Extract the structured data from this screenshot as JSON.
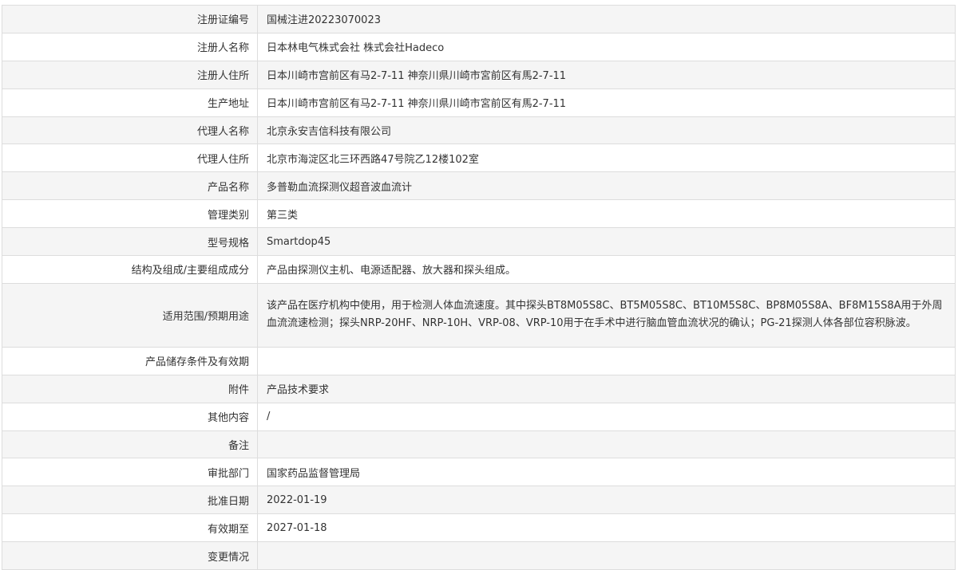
{
  "record": {
    "rows": [
      {
        "label": "注册证编号",
        "value": "国械注进20223070023"
      },
      {
        "label": "注册人名称",
        "value": "日本林电气株式会社 株式会社Hadeco"
      },
      {
        "label": "注册人住所",
        "value": "日本川崎市宫前区有马2-7-11 神奈川県川崎市宮前区有馬2-7-11"
      },
      {
        "label": "生产地址",
        "value": "日本川崎市宫前区有马2-7-11 神奈川県川崎市宮前区有馬2-7-11"
      },
      {
        "label": "代理人名称",
        "value": "北京永安吉信科技有限公司"
      },
      {
        "label": "代理人住所",
        "value": "北京市海淀区北三环西路47号院乙12楼102室"
      },
      {
        "label": "产品名称",
        "value": "多普勒血流探测仪超音波血流计"
      },
      {
        "label": "管理类别",
        "value": "第三类"
      },
      {
        "label": "型号规格",
        "value": "Smartdop45"
      },
      {
        "label": "结构及组成/主要组成成分",
        "value": "产品由探测仪主机、电源适配器、放大器和探头组成。"
      },
      {
        "label": "适用范围/预期用途",
        "value": "该产品在医疗机构中使用，用于检测人体血流速度。其中探头BT8M05S8C、BT5M05S8C、BT10M5S8C、BP8M05S8A、BF8M15S8A用于外周血流流速检测；探头NRP-20HF、NRP-10H、VRP-08、VRP-10用于在手术中进行脑血管血流状况的确认；PG-21探测人体各部位容积脉波。"
      },
      {
        "label": "产品储存条件及有效期",
        "value": ""
      },
      {
        "label": "附件",
        "value": "产品技术要求"
      },
      {
        "label": "其他内容",
        "value": "/"
      },
      {
        "label": "备注",
        "value": ""
      },
      {
        "label": "审批部门",
        "value": "国家药品监督管理局"
      },
      {
        "label": "批准日期",
        "value": "2022-01-19"
      },
      {
        "label": "有效期至",
        "value": "2027-01-18"
      },
      {
        "label": "变更情况",
        "value": ""
      }
    ]
  }
}
